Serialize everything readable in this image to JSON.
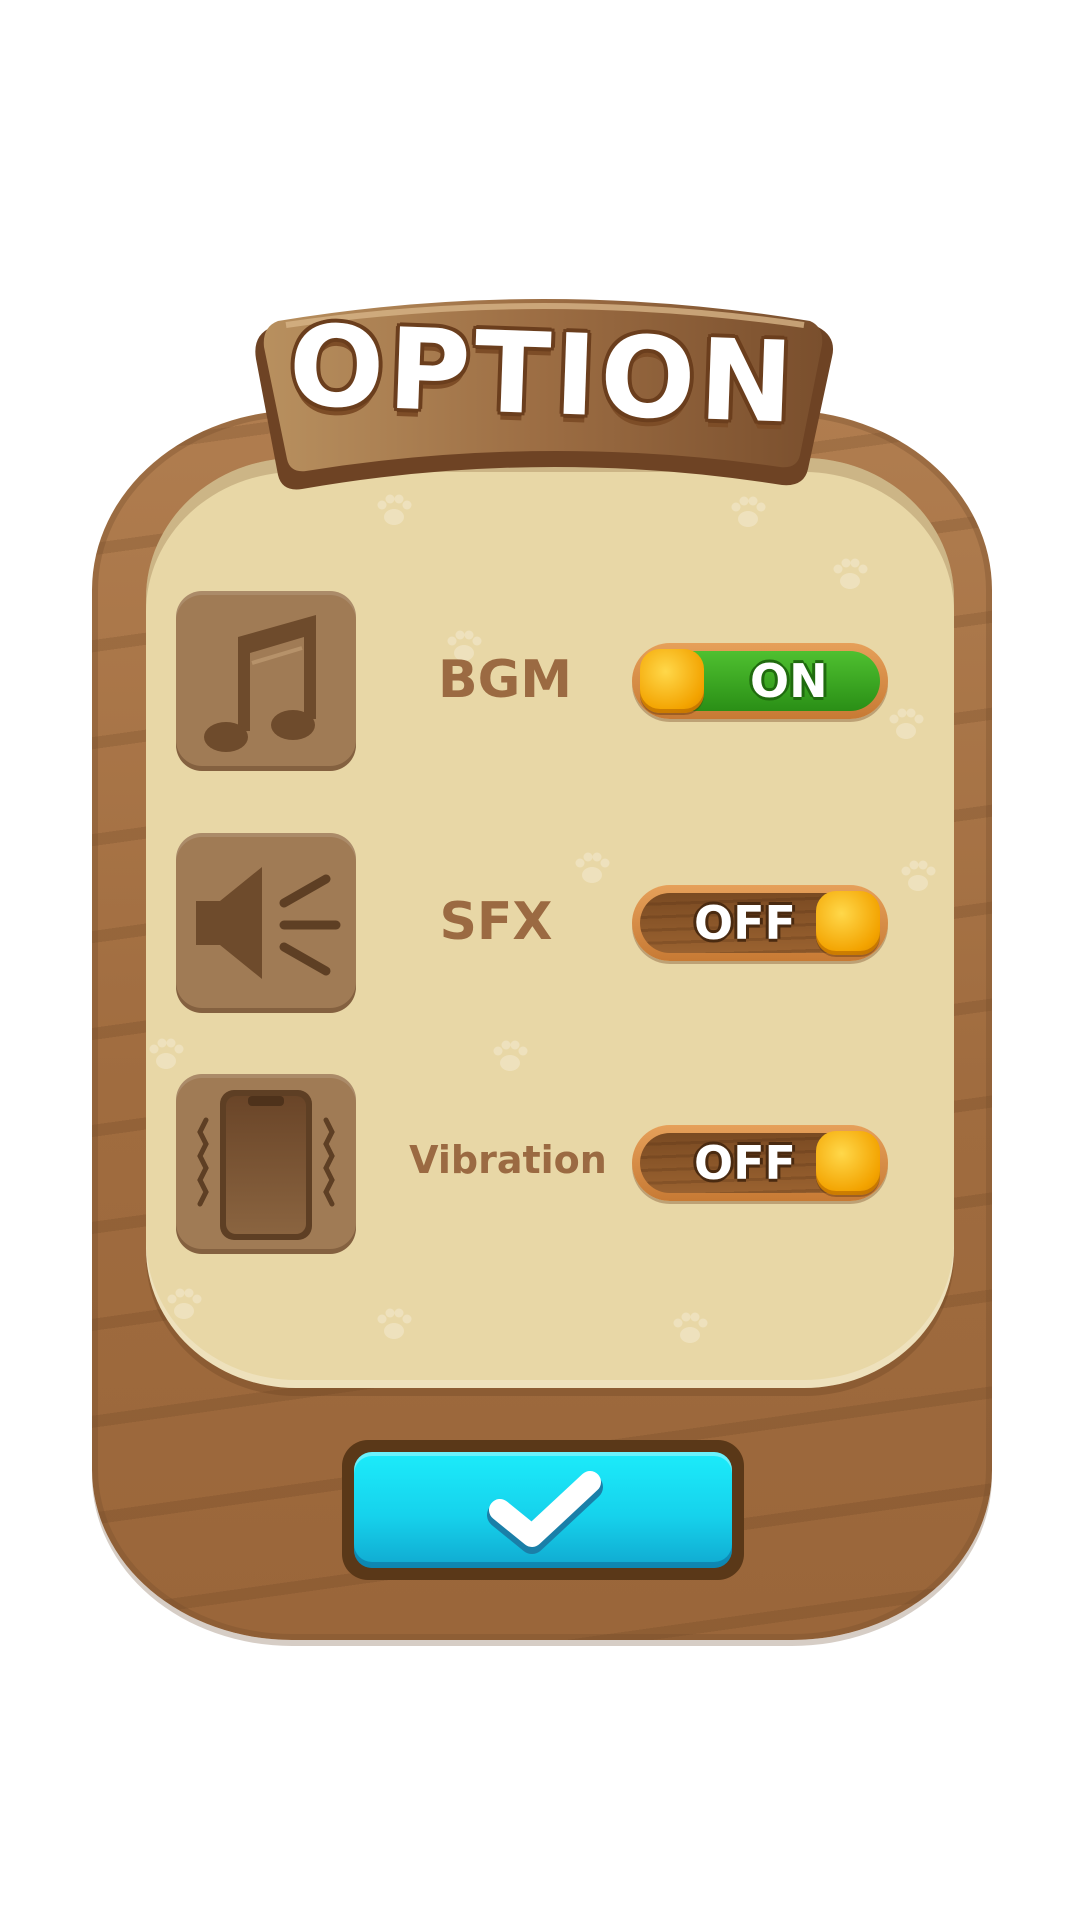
{
  "dialog": {
    "title": "OPTION",
    "settings": [
      {
        "label": "BGM",
        "icon": "music-note-icon",
        "state": "ON"
      },
      {
        "label": "SFX",
        "icon": "speaker-icon",
        "state": "OFF"
      },
      {
        "label": "Vibration",
        "icon": "phone-vibration-icon",
        "state": "OFF"
      }
    ],
    "confirm_icon": "checkmark-icon"
  },
  "colors": {
    "wood": "#a06c3f",
    "panel": "#e8d7a6",
    "tile": "#a07b55",
    "label": "#9b6a42",
    "toggle_on": "#2a8f16",
    "toggle_off": "#7a4a22",
    "knob": "#f3a300",
    "confirm": "#16d2ec"
  }
}
